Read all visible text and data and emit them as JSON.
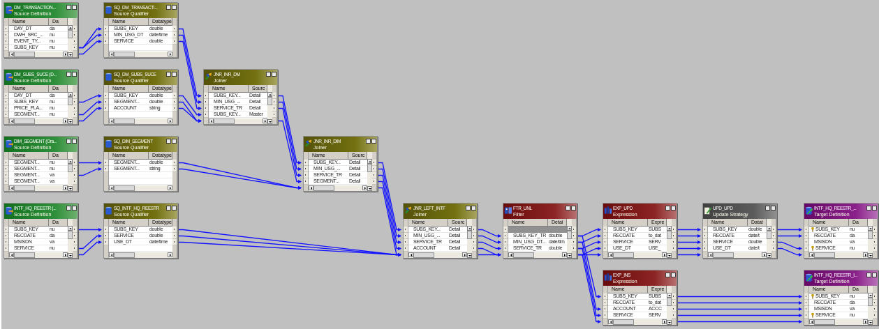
{
  "nodes": [
    {
      "title": "DM_TRANSACTION...",
      "subtitle": "Source Definition",
      "kind": "source",
      "columns": [
        "Name",
        "Da"
      ],
      "rows": [
        {
          "name": "DAY_DT",
          "type": "da"
        },
        {
          "name": "DWH_SRC_...",
          "type": "nu"
        },
        {
          "name": "EVENT_TY...",
          "type": "nu"
        },
        {
          "name": "SUBS_KEY",
          "type": "nu"
        }
      ]
    },
    {
      "title": "SQ_DM_TRANSACTI...",
      "subtitle": "Source Qualifier",
      "kind": "qualifier",
      "columns": [
        "Name",
        "Datatype"
      ],
      "rows": [
        {
          "name": "SUBS_KEY",
          "type": "double"
        },
        {
          "name": "MIN_USG_DT",
          "type": "date/time"
        },
        {
          "name": "SERVICE",
          "type": "double"
        }
      ]
    },
    {
      "title": "DM_SUBS_SUCE (D...",
      "subtitle": "Source Definition",
      "kind": "source",
      "columns": [
        "Name",
        "Da"
      ],
      "rows": [
        {
          "name": "DAY_DT",
          "type": "da"
        },
        {
          "name": "SUBS_KEY",
          "type": "nu"
        },
        {
          "name": "PRICE_PLA...",
          "type": "nu"
        },
        {
          "name": "SEGMENT...",
          "type": "nu"
        }
      ]
    },
    {
      "title": "SQ_DM_SUBS_SUCE",
      "subtitle": "Source Qualifier",
      "kind": "qualifier",
      "columns": [
        "Name",
        "Datatype"
      ],
      "rows": [
        {
          "name": "SUBS_KEY",
          "type": "double"
        },
        {
          "name": "SEGMENT...",
          "type": "double"
        },
        {
          "name": "ACCOUNT",
          "type": "string"
        }
      ]
    },
    {
      "title": "DIM_SEGMENT (Ora...",
      "subtitle": "Source Definition",
      "kind": "source",
      "columns": [
        "Name",
        "Da"
      ],
      "rows": [
        {
          "name": "SEGMENT...",
          "type": "nu"
        },
        {
          "name": "SEGMENT...",
          "type": "nu"
        },
        {
          "name": "SEGMENT...",
          "type": "va"
        },
        {
          "name": "SEGMENT...",
          "type": "va"
        }
      ]
    },
    {
      "title": "SQ_DIM_SEGMENT",
      "subtitle": "Source Qualifier",
      "kind": "qualifier",
      "columns": [
        "Name",
        "Datatype"
      ],
      "rows": [
        {
          "name": "SEGMENT...",
          "type": "double"
        },
        {
          "name": "SEGMENT...",
          "type": "string"
        }
      ]
    },
    {
      "title": "INTF_HQ_REESTR (...",
      "subtitle": "Source Definition",
      "kind": "source",
      "columns": [
        "Name",
        "Da"
      ],
      "rows": [
        {
          "name": "SUBS_KEY",
          "type": "nu"
        },
        {
          "name": "RECDATE",
          "type": "da"
        },
        {
          "name": "MSISDN",
          "type": "va"
        },
        {
          "name": "SERVICE",
          "type": "nu"
        }
      ]
    },
    {
      "title": "SQ_INTF_HQ_REESTR",
      "subtitle": "Source Qualifier",
      "kind": "qualifier",
      "columns": [
        "Name",
        "Datatype"
      ],
      "rows": [
        {
          "name": "SUBS_KEY",
          "type": "double"
        },
        {
          "name": "SERVICE",
          "type": "double"
        },
        {
          "name": "USE_DT",
          "type": "date/time"
        }
      ]
    },
    {
      "title": "JNR_INR_DM",
      "subtitle": "Joiner",
      "kind": "joiner",
      "columns": [
        "Name",
        "Sourc"
      ],
      "rows": [
        {
          "name": "SUBS_KEY...",
          "type": "Detail"
        },
        {
          "name": "MIN_USG_...",
          "type": "Detail"
        },
        {
          "name": "SERVICE_TR",
          "type": "Detail"
        },
        {
          "name": "SUBS_KEY...",
          "type": "Master"
        }
      ]
    },
    {
      "title": "JNR_INR_DIM",
      "subtitle": "Joiner",
      "kind": "joiner",
      "columns": [
        "Name",
        "Sourc"
      ],
      "rows": [
        {
          "name": "SUBS_KEY...",
          "type": "Detail"
        },
        {
          "name": "MIN_USG_...",
          "type": "Detail"
        },
        {
          "name": "SERVICE_TR",
          "type": "Detail"
        },
        {
          "name": "SEGMENT...",
          "type": "Detail"
        }
      ]
    },
    {
      "title": "JNR_LEFT_INTF",
      "subtitle": "Joiner",
      "kind": "joiner",
      "columns": [
        "Name",
        "Sourc"
      ],
      "rows": [
        {
          "name": "SUBS_KEY...",
          "type": "Detail"
        },
        {
          "name": "MIN_USG_...",
          "type": "Detail"
        },
        {
          "name": "SERVICE_TR",
          "type": "Detail"
        },
        {
          "name": "ACCOUNT",
          "type": "Detail"
        }
      ]
    },
    {
      "title": "FTR_UNL",
      "subtitle": "Filter",
      "kind": "filter",
      "columns": [
        "Name",
        "Detai"
      ],
      "rows": [
        {
          "kind": "group"
        },
        {
          "kind": "port",
          "name": "SUBS_KEY_TR",
          "type": "double"
        },
        {
          "kind": "port",
          "name": "MIN_USG_DT...",
          "type": "date/tim"
        },
        {
          "kind": "port",
          "name": "SERVICE_TR",
          "type": "double"
        }
      ]
    },
    {
      "title": "EXP_UPD",
      "subtitle": "Expression",
      "kind": "expression",
      "columns": [
        "Name",
        "Expre"
      ],
      "rows": [
        {
          "name": "SUBS_KEY",
          "type": "SUBS"
        },
        {
          "name": "RECDATE",
          "type": "to_dat"
        },
        {
          "name": "SERVICE",
          "type": "SERV"
        },
        {
          "name": "USE_DT",
          "type": "USE_"
        }
      ]
    },
    {
      "title": "UPD_UPD",
      "subtitle": "Update Strategy",
      "kind": "update",
      "columns": [
        "Name",
        "Datat"
      ],
      "rows": [
        {
          "name": "SUBS_KEY",
          "type": "double"
        },
        {
          "name": "RECDATE",
          "type": "date/t"
        },
        {
          "name": "SERVICE",
          "type": "double"
        },
        {
          "name": "USE_DT",
          "type": "date/t"
        }
      ]
    },
    {
      "title": "INTF_HQ_REESTR_...",
      "subtitle": "Target Definition",
      "kind": "target",
      "columns": [
        "Name",
        "Da"
      ],
      "rows": [
        {
          "name": "SUBS_KEY",
          "type": "nu",
          "key": true
        },
        {
          "name": "RECDATE",
          "type": "da",
          "key": false
        },
        {
          "name": "MSISDN",
          "type": "va",
          "key": false
        },
        {
          "name": "SERVICE",
          "type": "nu",
          "key": true
        }
      ]
    },
    {
      "title": "EXP_INS",
      "subtitle": "Expression",
      "kind": "expression",
      "columns": [
        "Name",
        "Expre"
      ],
      "rows": [
        {
          "name": "SUBS_KEY",
          "type": "SUBS"
        },
        {
          "name": "RECDATE",
          "type": "to_dat"
        },
        {
          "name": "ACCOUNT",
          "type": "ACCC"
        },
        {
          "name": "SERVICE",
          "type": "SERV"
        }
      ]
    },
    {
      "title": "INTF_HQ_REESTR_I...",
      "subtitle": "Target Definition",
      "kind": "target",
      "columns": [
        "Name",
        "Da"
      ],
      "rows": [
        {
          "name": "SUBS_KEY",
          "type": "nu",
          "key": true
        },
        {
          "name": "RECDATE",
          "type": "da",
          "key": false
        },
        {
          "name": "MSISDN",
          "type": "va",
          "key": false
        },
        {
          "name": "SERVICE",
          "type": "nu",
          "key": true
        }
      ]
    }
  ]
}
